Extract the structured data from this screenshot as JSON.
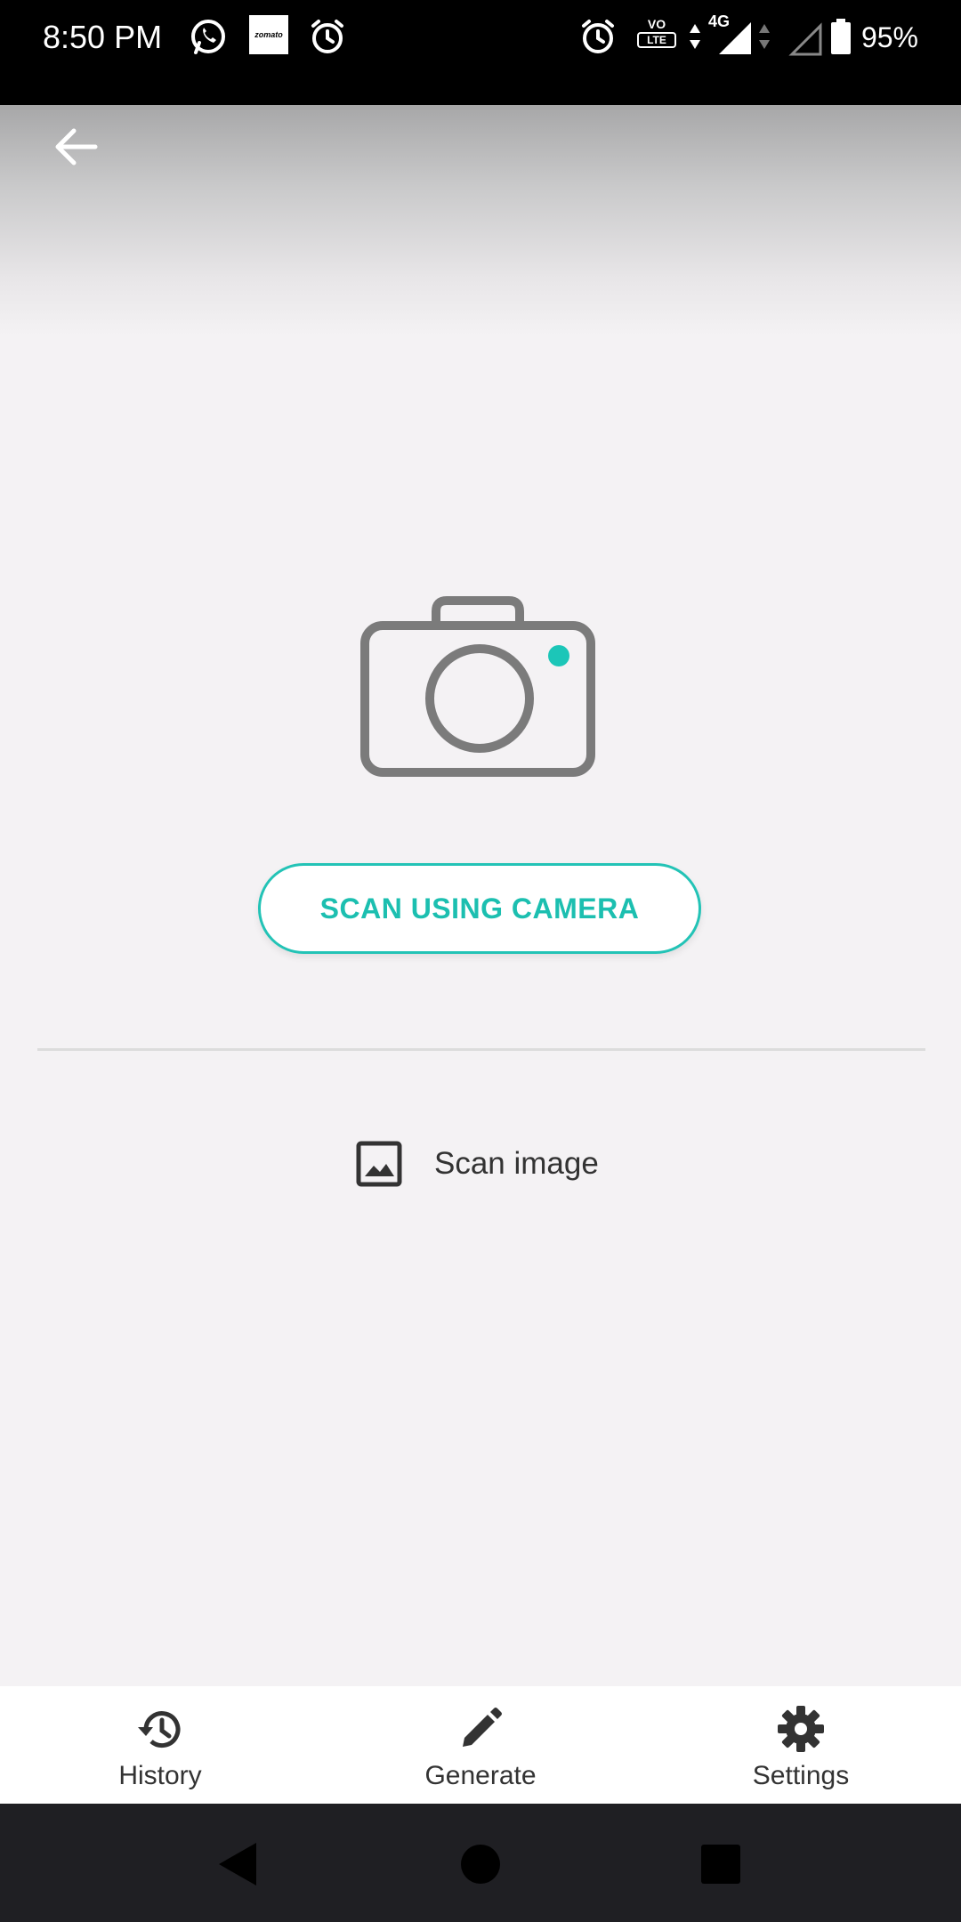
{
  "status_bar": {
    "time": "8:50 PM",
    "zomato_label": "zomato",
    "volte_top": "VO",
    "volte_bottom": "LTE",
    "network": "4G",
    "battery": "95%",
    "icons": [
      "whatsapp-icon",
      "zomato-icon",
      "alarm-icon",
      "alarm-icon",
      "volte-icon",
      "signal-icon",
      "signal-icon",
      "battery-icon"
    ]
  },
  "main": {
    "scan_camera_label": "SCAN USING CAMERA",
    "scan_image_label": "Scan image",
    "accent_color": "#23c3b6"
  },
  "bottom_nav": {
    "items": [
      {
        "label": "History",
        "icon": "history-icon"
      },
      {
        "label": "Generate",
        "icon": "pencil-icon"
      },
      {
        "label": "Settings",
        "icon": "gear-icon"
      }
    ]
  },
  "system_nav": {
    "buttons": [
      "back-triangle-icon",
      "home-circle-icon",
      "recents-square-icon"
    ]
  }
}
